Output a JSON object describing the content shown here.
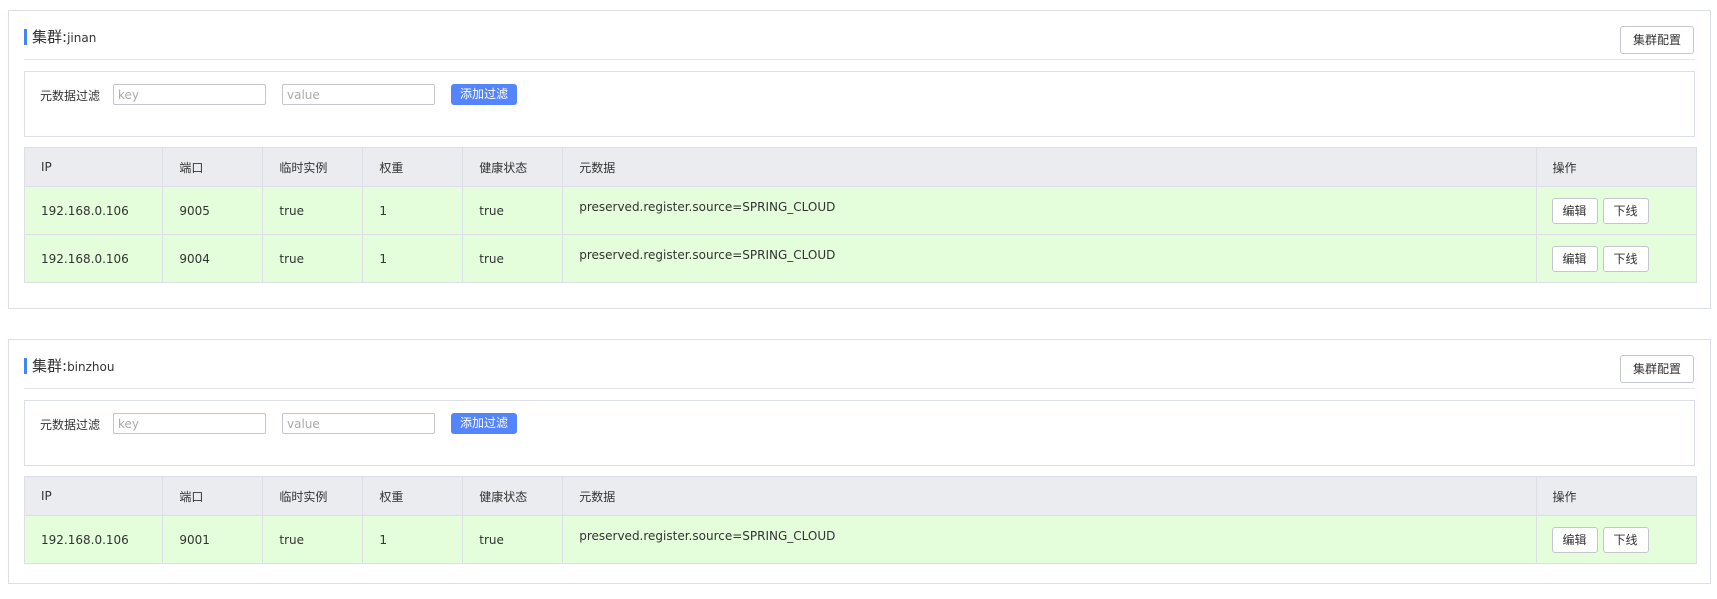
{
  "clusters": [
    {
      "title_prefix": "集群:",
      "name": "jinan",
      "config_button": "集群配置",
      "filter": {
        "label": "元数据过滤",
        "key_placeholder": "key",
        "value_placeholder": "value",
        "add_button": "添加过滤"
      },
      "columns": [
        "IP",
        "端口",
        "临时实例",
        "权重",
        "健康状态",
        "元数据",
        "操作"
      ],
      "rows": [
        {
          "ip": "192.168.0.106",
          "port": "9005",
          "ephemeral": "true",
          "weight": "1",
          "healthy": "true",
          "metadata": "preserved.register.source=SPRING_CLOUD",
          "edit": "编辑",
          "offline": "下线"
        },
        {
          "ip": "192.168.0.106",
          "port": "9004",
          "ephemeral": "true",
          "weight": "1",
          "healthy": "true",
          "metadata": "preserved.register.source=SPRING_CLOUD",
          "edit": "编辑",
          "offline": "下线"
        }
      ]
    },
    {
      "title_prefix": "集群:",
      "name": "binzhou",
      "config_button": "集群配置",
      "filter": {
        "label": "元数据过滤",
        "key_placeholder": "key",
        "value_placeholder": "value",
        "add_button": "添加过滤"
      },
      "columns": [
        "IP",
        "端口",
        "临时实例",
        "权重",
        "健康状态",
        "元数据",
        "操作"
      ],
      "rows": [
        {
          "ip": "192.168.0.106",
          "port": "9001",
          "ephemeral": "true",
          "weight": "1",
          "healthy": "true",
          "metadata": "preserved.register.source=SPRING_CLOUD",
          "edit": "编辑",
          "offline": "下线"
        }
      ]
    }
  ],
  "colors": {
    "accent": "#4285f4",
    "primary_button": "#5584ff",
    "table_header_bg": "#ebecf0",
    "healthy_row_bg": "#e4fdda"
  }
}
